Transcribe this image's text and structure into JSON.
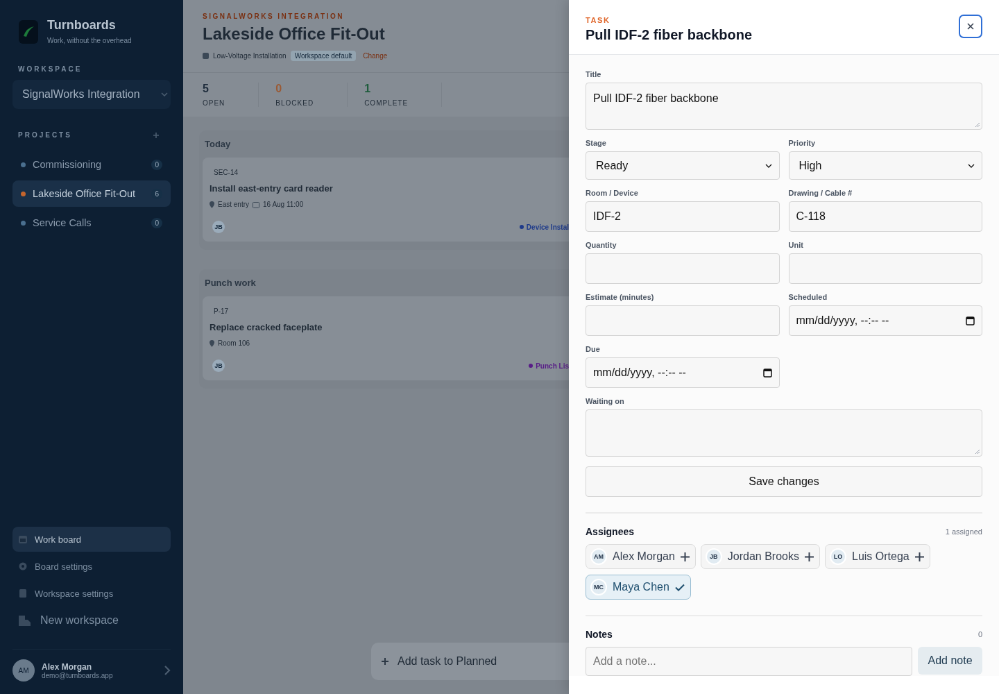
{
  "sidebar": {
    "brand": "Turnboards",
    "tagline": "Work, without the overhead",
    "workspace_label": "WORKSPACE",
    "workspace": "SignalWorks Integration",
    "projects_label": "PROJECTS",
    "projects": [
      {
        "name": "Commissioning",
        "count": "0",
        "color": "#4a6f8f",
        "selected": false
      },
      {
        "name": "Lakeside Office Fit-Out",
        "count": "6",
        "color": "#c5652d",
        "selected": true
      },
      {
        "name": "Service Calls",
        "count": "0",
        "color": "#4a6f8f",
        "selected": false
      }
    ],
    "nav": [
      {
        "label": "Work board",
        "kind": "board",
        "selected": true
      },
      {
        "label": "Board settings",
        "kind": "gear",
        "selected": false
      },
      {
        "label": "Workspace settings",
        "kind": "panel",
        "selected": false
      },
      {
        "label": "New workspace",
        "kind": "building",
        "selected": false
      }
    ],
    "user": {
      "initials": "AM",
      "name": "Alex Morgan",
      "email": "demo@turnboards.app"
    }
  },
  "main": {
    "org": "SIGNALWORKS INTEGRATION",
    "title": "Lakeside Office Fit-Out",
    "template": "Low-Voltage Installation",
    "badge": "Workspace default",
    "action": "Change",
    "stats": [
      {
        "value": "5",
        "label": "OPEN",
        "color": "#1f2d3d"
      },
      {
        "value": "0",
        "label": "BLOCKED",
        "color": "#9a5a35"
      },
      {
        "value": "1",
        "label": "COMPLETE",
        "color": "#1f5c3d"
      }
    ],
    "columns": [
      {
        "title": "Today",
        "cards": [
          {
            "id": "SEC-14",
            "title": "Install east-entry card reader",
            "location": "East entry",
            "date": "16 Aug 11:00",
            "assignee": "JB",
            "tag": "Device Instal",
            "color": "#1e3a8a"
          }
        ]
      },
      {
        "title": "Punch work",
        "cards": [
          {
            "id": "P-17",
            "title": "Replace cracked faceplate",
            "location": "Room 106",
            "assignee": "JB",
            "tag": "Punch Lis",
            "color": "#581c87"
          }
        ]
      }
    ],
    "add_task": "Add task to Planned"
  },
  "drawer": {
    "eyebrow": "TASK",
    "title": "Pull IDF-2 fiber backbone",
    "fields": [
      {
        "label": "Title",
        "kind": "textarea",
        "value": "Pull IDF-2 fiber backbone"
      },
      {
        "label": "Stage",
        "kind": "select",
        "value": "Ready"
      },
      {
        "label": "Priority",
        "kind": "select",
        "value": "High"
      },
      {
        "label": "Room / Device",
        "kind": "text",
        "value": "IDF-2"
      },
      {
        "label": "Drawing / Cable #",
        "kind": "text",
        "value": "C-118"
      },
      {
        "label": "Quantity",
        "kind": "text"
      },
      {
        "label": "Unit",
        "kind": "text"
      },
      {
        "label": "Estimate (minutes)",
        "kind": "text"
      },
      {
        "label": "Scheduled",
        "kind": "datetime",
        "value": "mm/dd/yyyy, --:-- --"
      },
      {
        "label": "Due",
        "kind": "datetime",
        "value": "mm/dd/yyyy, --:-- --"
      },
      {
        "label": "Waiting on",
        "kind": "textarea"
      }
    ],
    "save": "Save changes",
    "assignees": {
      "title": "Assignees",
      "count": "1 assigned",
      "people": [
        {
          "initials": "AM",
          "name": "Alex Morgan",
          "selected": false
        },
        {
          "initials": "JB",
          "name": "Jordan Brooks",
          "selected": false
        },
        {
          "initials": "LO",
          "name": "Luis Ortega",
          "selected": false
        },
        {
          "initials": "MC",
          "name": "Maya Chen",
          "selected": true
        }
      ]
    },
    "notes": {
      "title": "Notes",
      "count": "0",
      "placeholder": "Add a note...",
      "button": "Add note"
    }
  }
}
